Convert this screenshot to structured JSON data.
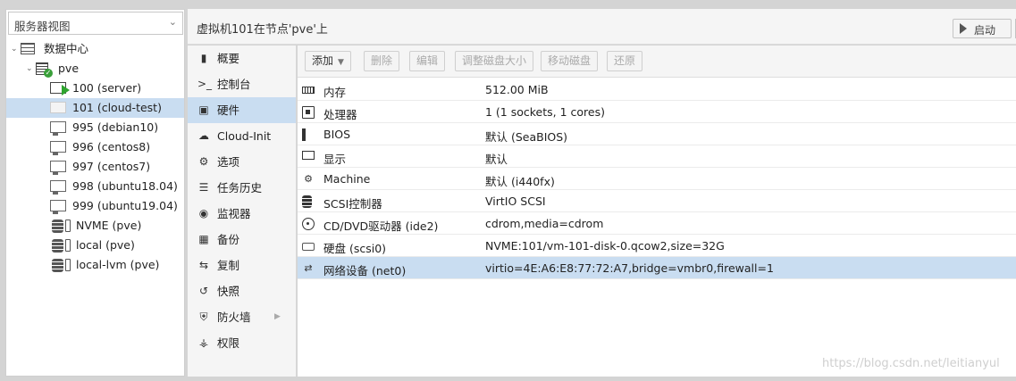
{
  "tree": {
    "view_selector": "服务器视图",
    "datacenter": "数据中心",
    "node": "pve",
    "vms": [
      {
        "label": "100 (server)"
      },
      {
        "label": "101 (cloud-test)"
      },
      {
        "label": "995 (debian10)"
      },
      {
        "label": "996 (centos8)"
      },
      {
        "label": "997 (centos7)"
      },
      {
        "label": "998 (ubuntu18.04)"
      },
      {
        "label": "999 (ubuntu19.04)"
      }
    ],
    "storages": [
      {
        "label": "NVME (pve)"
      },
      {
        "label": "local (pve)"
      },
      {
        "label": "local-lvm (pve)"
      }
    ]
  },
  "header": {
    "title": "虚拟机101在节点'pve'上",
    "start_label": "启动"
  },
  "nav": {
    "items": [
      {
        "label": "概要",
        "icon": "book-icon"
      },
      {
        "label": "控制台",
        "icon": "terminal-icon"
      },
      {
        "label": "硬件",
        "icon": "desktop-icon"
      },
      {
        "label": "Cloud-Init",
        "icon": "cloud-icon"
      },
      {
        "label": "选项",
        "icon": "gear-icon"
      },
      {
        "label": "任务历史",
        "icon": "list-icon"
      },
      {
        "label": "监视器",
        "icon": "eye-icon"
      },
      {
        "label": "备份",
        "icon": "floppy-icon"
      },
      {
        "label": "复制",
        "icon": "retweet-icon"
      },
      {
        "label": "快照",
        "icon": "history-icon"
      },
      {
        "label": "防火墙",
        "icon": "shield-icon"
      },
      {
        "label": "权限",
        "icon": "unlock-icon"
      }
    ]
  },
  "toolbar": {
    "add": "添加",
    "remove": "删除",
    "edit": "编辑",
    "resize": "调整磁盘大小",
    "move": "移动磁盘",
    "revert": "还原"
  },
  "hardware": [
    {
      "name": "内存",
      "value": "512.00 MiB",
      "icon": "memory-icon"
    },
    {
      "name": "处理器",
      "value": "1 (1 sockets, 1 cores)",
      "icon": "cpu-icon"
    },
    {
      "name": "BIOS",
      "value": "默认 (SeaBIOS)",
      "icon": "bios-icon"
    },
    {
      "name": "显示",
      "value": "默认",
      "icon": "display-icon"
    },
    {
      "name": "Machine",
      "value": "默认 (i440fx)",
      "icon": "cogs-icon"
    },
    {
      "name": "SCSI控制器",
      "value": "VirtIO SCSI",
      "icon": "database-icon"
    },
    {
      "name": "CD/DVD驱动器 (ide2)",
      "value": "cdrom,media=cdrom",
      "icon": "cdrom-icon"
    },
    {
      "name": "硬盘 (scsi0)",
      "value": "NVME:101/vm-101-disk-0.qcow2,size=32G",
      "icon": "hdd-icon"
    },
    {
      "name": "网络设备 (net0)",
      "value": "virtio=4E:A6:E8:77:72:A7,bridge=vmbr0,firewall=1",
      "icon": "exchange-icon"
    }
  ],
  "watermark": "https://blog.csdn.net/leitianyul"
}
